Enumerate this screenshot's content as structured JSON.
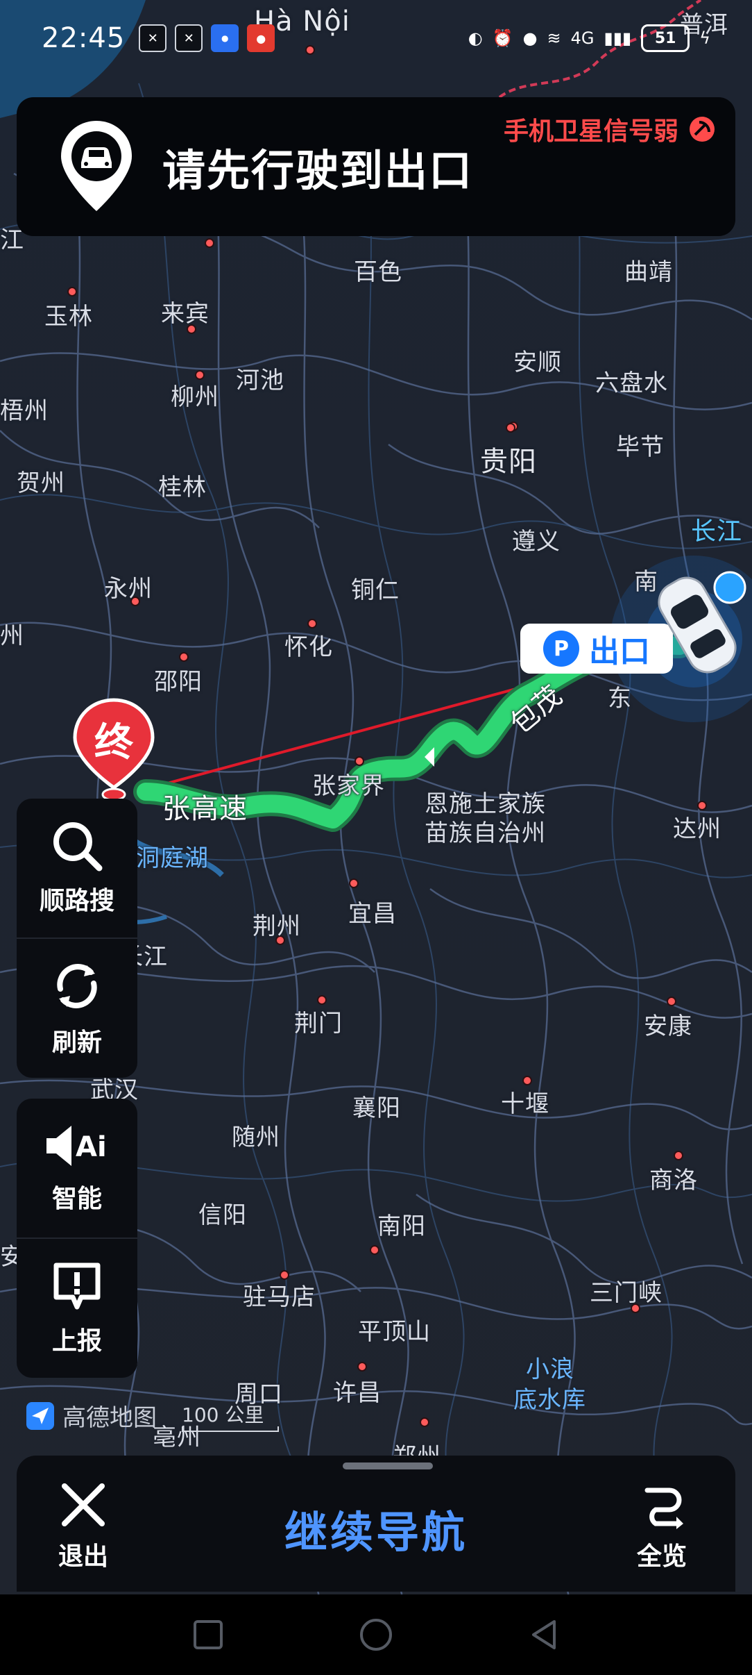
{
  "status_bar": {
    "time": "22:45",
    "battery": "51",
    "network": "4G"
  },
  "banner": {
    "title": "请先行驶到出口",
    "gps_warning": "手机卫星信号弱"
  },
  "map_labels": {
    "hanoi": "Hà Nội",
    "puer": "普洱",
    "jiang": "江",
    "baise": "百色",
    "qujing": "曲靖",
    "yulin": "玉林",
    "laibin": "来宾",
    "anshun": "安顺",
    "liupanshui": "六盘水",
    "hechi": "河池",
    "liuzhou": "柳州",
    "wuzhou": "梧州",
    "guiyang": "贵阳",
    "bijie": "毕节",
    "hezhou": "贺州",
    "guilin": "桂林",
    "zunyi": "遵义",
    "changjiang": "长江",
    "nan": "南",
    "yongzhou": "永州",
    "tongren": "铜仁",
    "huaihua": "怀化",
    "zhou": "州",
    "shaoyang": "邵阳",
    "dong": "东",
    "zhangjiajie": "张家界",
    "zhanggao": "张高速",
    "enshi1": "恩施土家族",
    "enshi2": "苗族自治州",
    "dazhou": "达州",
    "dongtinghu": "洞庭湖",
    "jingzhou": "荆州",
    "yichang": "宜昌",
    "changjiang2": "长江",
    "jingmen": "荆门",
    "ankang": "安康",
    "wuhan": "武汉",
    "xiangyang": "襄阳",
    "shiyan": "十堰",
    "suizhou": "随州",
    "shangluo": "商洛",
    "xinyang": "信阳",
    "nanyang": "南阳",
    "an": "安",
    "zhumadian": "驻马店",
    "sanmenxia": "三门峡",
    "pingdingshan": "平顶山",
    "xiaolangdi1": "小浪",
    "xiaolangdi2": "底水库",
    "zhoukou": "周口",
    "xuchang": "许昌",
    "bozhou": "亳州",
    "zhengzhou": "郑州",
    "route_road": "包茂"
  },
  "route_markers": {
    "exit_label": "出口",
    "parking_letter": "P",
    "end_label": "终"
  },
  "left_tools": {
    "search_label": "顺路搜",
    "refresh_label": "刷新",
    "smart_label": "智能",
    "report_label": "上报"
  },
  "map_footer": {
    "brand": "高德地图",
    "scale": "100 公里"
  },
  "bottom_bar": {
    "exit_label": "退出",
    "continue_label": "继续导航",
    "overview_label": "全览"
  }
}
